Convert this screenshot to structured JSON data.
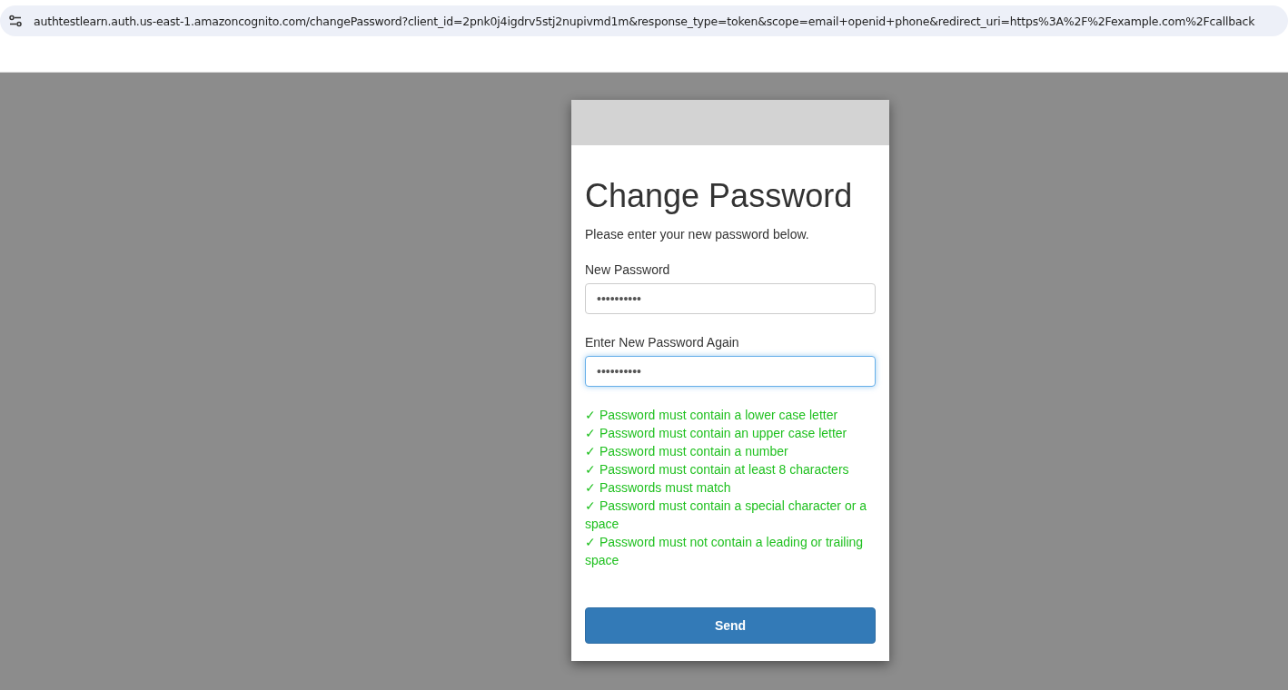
{
  "browser": {
    "address": "authtestlearn.auth.us-east-1.amazoncognito.com/changePassword?client_id=2pnk0j4igdrv5stj2nupivmd1m&response_type=token&scope=email+openid+phone&redirect_uri=https%3A%2F%2Fexample.com%2Fcallback"
  },
  "form": {
    "title": "Change Password",
    "subtitle": "Please enter your new password below.",
    "fields": [
      {
        "label": "New Password",
        "value": "••••••••••",
        "focused": false
      },
      {
        "label": "Enter New Password Again",
        "value": "••••••••••",
        "focused": true
      }
    ],
    "requirements": [
      {
        "text": "✓ Password must contain a lower case letter",
        "met": true
      },
      {
        "text": "✓ Password must contain an upper case letter",
        "met": true
      },
      {
        "text": "✓ Password must contain a number",
        "met": true
      },
      {
        "text": "✓ Password must contain at least 8 characters",
        "met": true
      },
      {
        "text": "✓ Passwords must match",
        "met": true
      },
      {
        "text": "✓ Password must contain a special character or a space",
        "met": true
      },
      {
        "text": "✓ Password must not contain a leading or trailing space",
        "met": true
      }
    ],
    "button": "Send"
  }
}
